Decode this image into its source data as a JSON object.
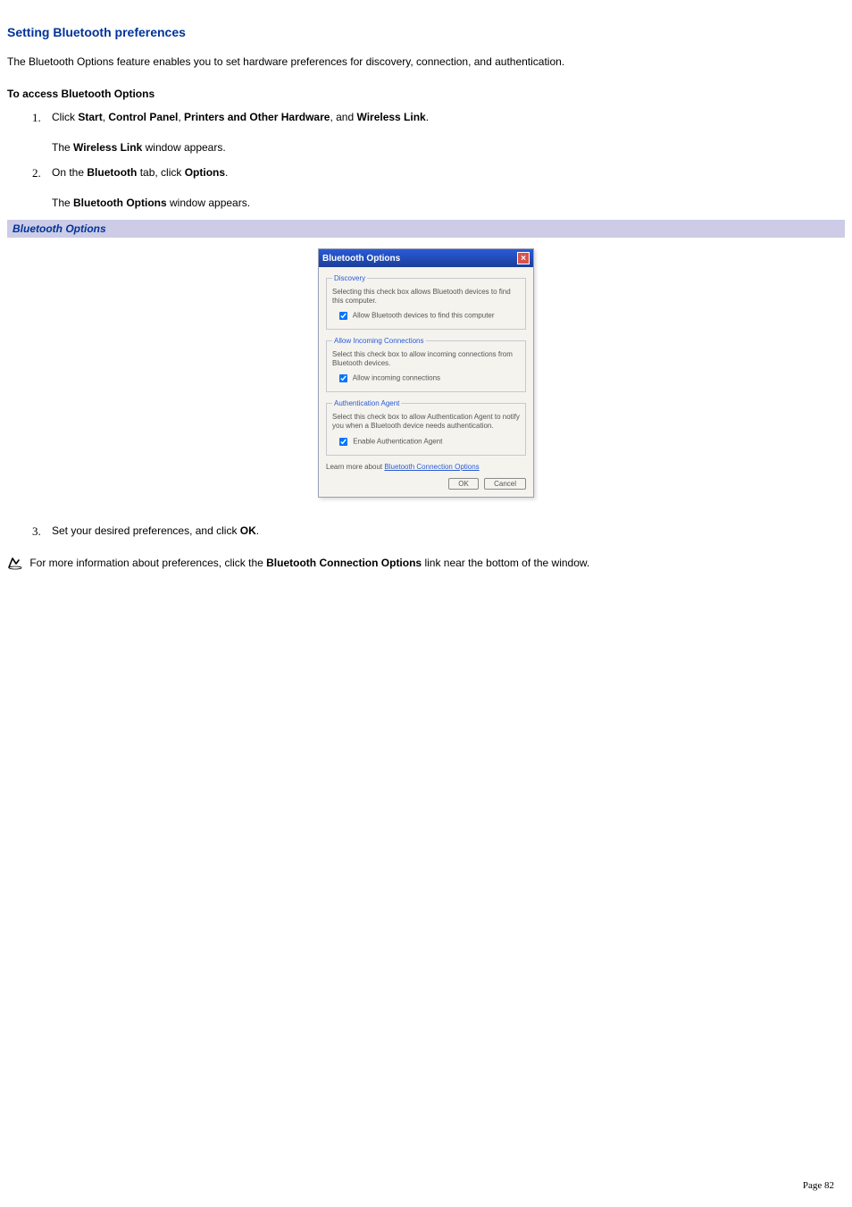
{
  "heading": "Setting Bluetooth preferences",
  "intro": "The Bluetooth Options feature enables you to set hardware preferences for discovery, connection, and authentication.",
  "subheading": "To access Bluetooth Options",
  "steps": {
    "s1": {
      "num": "1.",
      "pre": "Click ",
      "b1": "Start",
      "sep1": ", ",
      "b2": "Control Panel",
      "sep2": ", ",
      "b3": "Printers and Other Hardware",
      "sep3": ", and ",
      "b4": "Wireless Link",
      "end": ".",
      "follow_pre": "The ",
      "follow_b": "Wireless Link",
      "follow_end": " window appears."
    },
    "s2": {
      "num": "2.",
      "pre": "On the ",
      "b1": "Bluetooth",
      "mid": " tab, click ",
      "b2": "Options",
      "end": ".",
      "follow_pre": "The ",
      "follow_b": "Bluetooth Options",
      "follow_end": " window appears."
    },
    "s3": {
      "num": "3.",
      "pre": "Set your desired preferences, and click ",
      "b1": "OK",
      "end": "."
    }
  },
  "figcaption": "Bluetooth Options",
  "dialog": {
    "title": "Bluetooth Options",
    "close": "×",
    "discovery": {
      "legend": "Discovery",
      "desc": "Selecting this check box allows Bluetooth devices to find this computer.",
      "chk": "Allow Bluetooth devices to find this computer"
    },
    "incoming": {
      "legend": "Allow Incoming Connections",
      "desc": "Select this check box to allow incoming connections from Bluetooth devices.",
      "chk": "Allow incoming connections"
    },
    "auth": {
      "legend": "Authentication Agent",
      "desc": "Select this check box to allow Authentication Agent to notify you when a Bluetooth device needs authentication.",
      "chk": "Enable Authentication Agent"
    },
    "learn_pre": "Learn more about ",
    "learn_link": "Bluetooth Connection Options",
    "ok": "OK",
    "cancel": "Cancel"
  },
  "note": {
    "pre": " For more information about preferences, click the ",
    "b": "Bluetooth Connection Options",
    "end": " link near the bottom of the window."
  },
  "page_label": "Page 82"
}
